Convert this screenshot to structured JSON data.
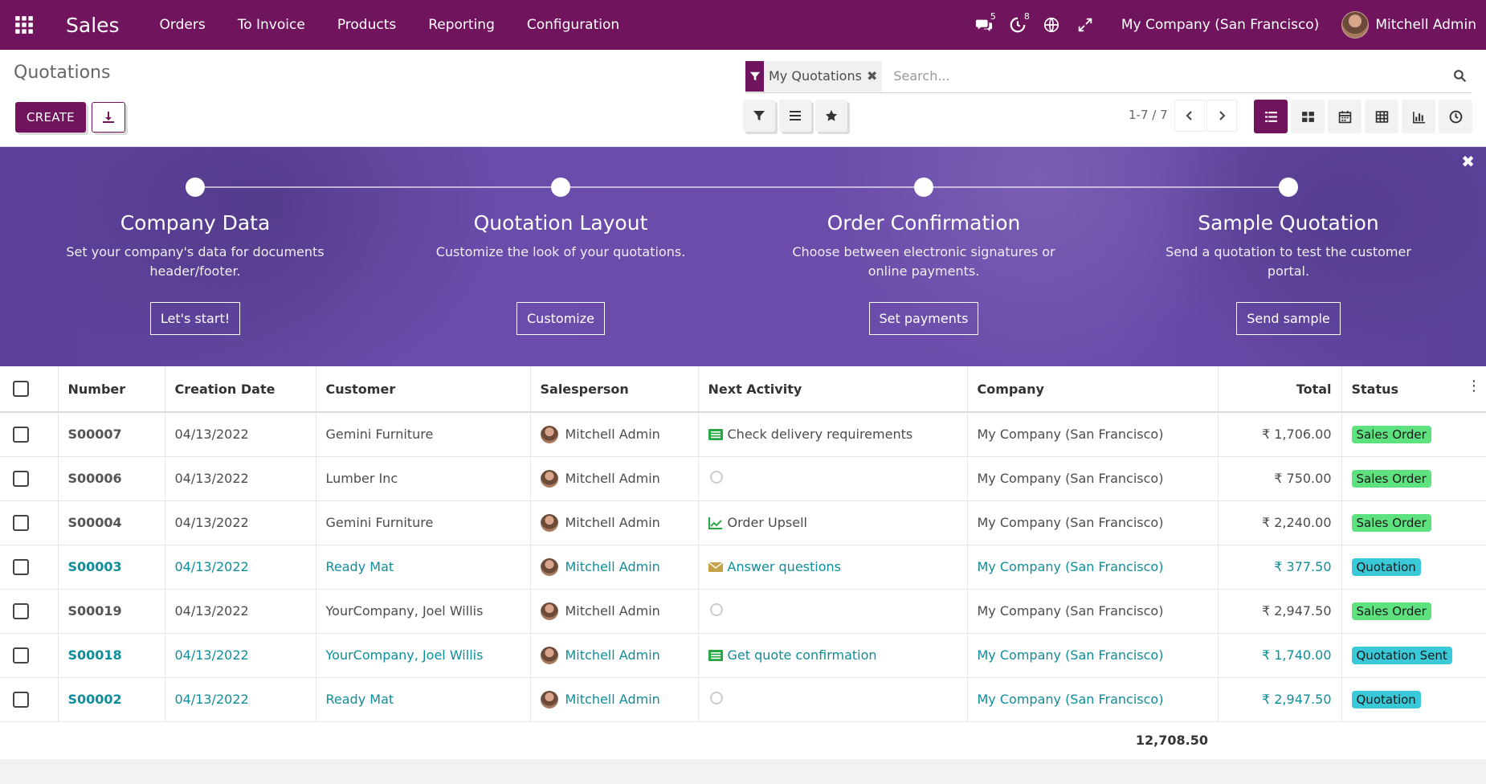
{
  "navbar": {
    "brand": "Sales",
    "menu": [
      "Orders",
      "To Invoice",
      "Products",
      "Reporting",
      "Configuration"
    ],
    "messages_count": "5",
    "activities_count": "8",
    "company": "My Company (San Francisco)",
    "user": "Mitchell Admin",
    "color": "#71145e"
  },
  "control": {
    "title": "Quotations",
    "create_label": "CREATE",
    "facet_label": "My Quotations",
    "search_placeholder": "Search...",
    "pager": "1-7 / 7"
  },
  "banner": {
    "steps": [
      {
        "title": "Company Data",
        "desc": "Set your company's data for documents header/footer.",
        "button": "Let's start!"
      },
      {
        "title": "Quotation Layout",
        "desc": "Customize the look of your quotations.",
        "button": "Customize"
      },
      {
        "title": "Order Confirmation",
        "desc": "Choose between electronic signatures or online payments.",
        "button": "Set payments"
      },
      {
        "title": "Sample Quotation",
        "desc": "Send a quotation to test the customer portal.",
        "button": "Send sample"
      }
    ]
  },
  "table": {
    "headers": [
      "Number",
      "Creation Date",
      "Customer",
      "Salesperson",
      "Next Activity",
      "Company",
      "Total",
      "Status"
    ],
    "rows": [
      {
        "number": "S00007",
        "date": "04/13/2022",
        "customer": "Gemini Furniture",
        "salesperson": "Mitchell Admin",
        "activity": "Check delivery requirements",
        "activity_icon": "todo-list-icon",
        "company": "My Company (San Francisco)",
        "total": "₹ 1,706.00",
        "status": "Sales Order",
        "style": "muted"
      },
      {
        "number": "S00006",
        "date": "04/13/2022",
        "customer": "Lumber Inc",
        "salesperson": "Mitchell Admin",
        "activity": "",
        "activity_icon": "clock-icon",
        "company": "My Company (San Francisco)",
        "total": "₹ 750.00",
        "status": "Sales Order",
        "style": "muted"
      },
      {
        "number": "S00004",
        "date": "04/13/2022",
        "customer": "Gemini Furniture",
        "salesperson": "Mitchell Admin",
        "activity": "Order Upsell",
        "activity_icon": "upsell-chart-icon",
        "company": "My Company (San Francisco)",
        "total": "₹ 2,240.00",
        "status": "Sales Order",
        "style": "muted"
      },
      {
        "number": "S00003",
        "date": "04/13/2022",
        "customer": "Ready Mat",
        "salesperson": "Mitchell Admin",
        "activity": "Answer questions",
        "activity_icon": "envelope-icon",
        "company": "My Company (San Francisco)",
        "total": "₹ 377.50",
        "status": "Quotation",
        "style": "link"
      },
      {
        "number": "S00019",
        "date": "04/13/2022",
        "customer": "YourCompany, Joel Willis",
        "salesperson": "Mitchell Admin",
        "activity": "",
        "activity_icon": "clock-icon",
        "company": "My Company (San Francisco)",
        "total": "₹ 2,947.50",
        "status": "Sales Order",
        "style": "muted"
      },
      {
        "number": "S00018",
        "date": "04/13/2022",
        "customer": "YourCompany, Joel Willis",
        "salesperson": "Mitchell Admin",
        "activity": "Get quote confirmation",
        "activity_icon": "todo-list-icon",
        "company": "My Company (San Francisco)",
        "total": "₹ 1,740.00",
        "status": "Quotation Sent",
        "style": "link"
      },
      {
        "number": "S00002",
        "date": "04/13/2022",
        "customer": "Ready Mat",
        "salesperson": "Mitchell Admin",
        "activity": "",
        "activity_icon": "clock-icon",
        "company": "My Company (San Francisco)",
        "total": "₹ 2,947.50",
        "status": "Quotation",
        "style": "link"
      }
    ],
    "sum_total": "12,708.50"
  },
  "colors": {
    "sales_order_badge": "#5ee17f",
    "quotation_badge": "#39c9d8",
    "link": "#0e8d9a",
    "banner": "#6a4cab"
  }
}
